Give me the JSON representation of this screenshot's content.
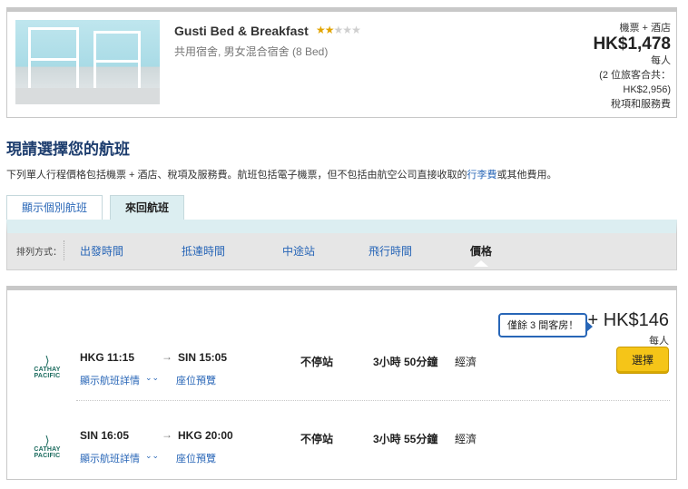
{
  "hotel": {
    "name": "Gusti Bed & Breakfast",
    "stars_filled": 2,
    "stars_total": 5,
    "room_type": "共用宿舍, 男女混合宿舍 (8 Bed)",
    "price_kind": "機票 + 酒店",
    "price": "HK$1,478",
    "per_person": "每人",
    "total_line1": "(2 位旅客合共：",
    "total_line2": "HK$2,956)",
    "tax_note": "稅項和服務費"
  },
  "section": {
    "title": "現請選擇您的航班",
    "note_before": "下列單人行程價格包括機票 + 酒店、稅項及服務費。航班包括電子機票，但不包括由航空公司直接收取的",
    "note_link": "行李費",
    "note_after": "或其他費用。"
  },
  "tabs": [
    {
      "label": "顯示個別航班"
    },
    {
      "label": "來回航班"
    }
  ],
  "sort": {
    "label": "排列方式：",
    "items": [
      {
        "label": "出發時間"
      },
      {
        "label": "抵達時間"
      },
      {
        "label": "中途站"
      },
      {
        "label": "飛行時間"
      },
      {
        "label": "價格"
      }
    ],
    "active": "價格"
  },
  "flight_option": {
    "rooms_tip": "僅餘 3 間客房！",
    "price": "+ HK$146",
    "per_person": "每人",
    "select_label": "選擇",
    "airline": "CATHAY PACIFIC",
    "legs": [
      {
        "dep": "HKG 11:15",
        "arr": "SIN 15:05",
        "stops": "不停站",
        "duration": "3小時 50分鐘",
        "cabin": "經濟",
        "details": "顯示航班詳情",
        "seat": "座位預覽"
      },
      {
        "dep": "SIN 16:05",
        "arr": "HKG 20:00",
        "stops": "不停站",
        "duration": "3小時 55分鐘",
        "cabin": "經濟",
        "details": "顯示航班詳情",
        "seat": "座位預覽"
      }
    ]
  },
  "colors": {
    "link": "#2866b7",
    "heading": "#1d3d6e",
    "select_button": "#f5c518",
    "star": "#e2a400",
    "airline": "#1b6b5e"
  },
  "icons": {
    "arrow": "right-arrow-icon",
    "expand": "chevron-down-icon",
    "airline_logo": "cathay-pacific-logo"
  }
}
